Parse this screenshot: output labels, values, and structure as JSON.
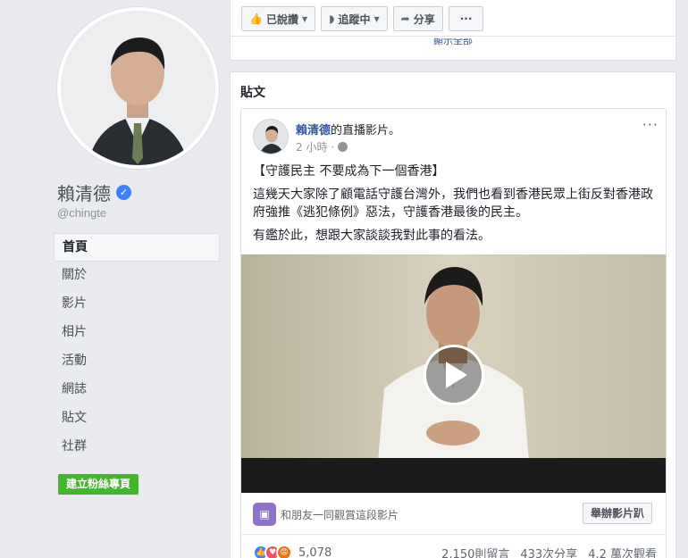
{
  "profile": {
    "name": "賴清德",
    "handle": "@chingte"
  },
  "nav": {
    "items": [
      {
        "label": "首頁"
      },
      {
        "label": "關於"
      },
      {
        "label": "影片"
      },
      {
        "label": "相片"
      },
      {
        "label": "活動"
      },
      {
        "label": "網誌"
      },
      {
        "label": "貼文"
      },
      {
        "label": "社群"
      }
    ],
    "create_page": "建立粉絲專頁"
  },
  "actions": {
    "liked": "已說讚",
    "following": "追蹤中",
    "share": "分享",
    "more": "···",
    "show_all": "顯示全部"
  },
  "posts_section": {
    "title": "貼文"
  },
  "post": {
    "author": "賴清德",
    "author_suffix": "的直播影片。",
    "time": "2 小時",
    "more": "···",
    "lines": [
      "【守護民主 不要成為下一個香港】",
      "這幾天大家除了顧電話守護台灣外，我們也看到香港民眾上街反對香港政府強推《逃犯條例》惡法，守護香港最後的民主。",
      "有鑑於此，想跟大家談談我對此事的看法。"
    ],
    "watch_together": "和朋友一同觀賞這段影片",
    "host_watch_party": "舉辦影片趴",
    "reaction_count": "5,078",
    "comments": "2,150則留言",
    "shares": "433次分享",
    "views": "4.2 萬次觀看"
  },
  "colors": {
    "page_bg": "#e9ebee",
    "link_blue": "#365899",
    "verified_blue": "#4080ff",
    "create_green": "#42b72a"
  }
}
